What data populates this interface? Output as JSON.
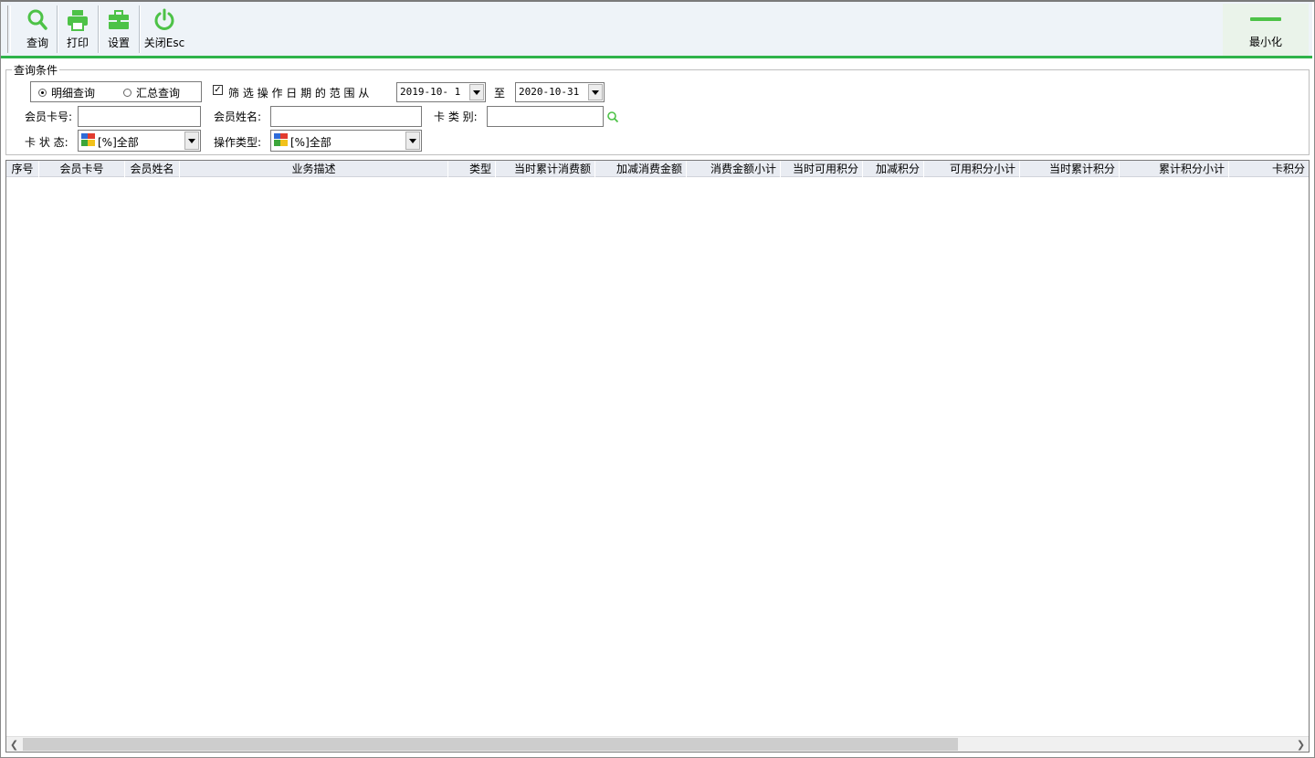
{
  "toolbar": {
    "query": {
      "label": "查询",
      "icon": "search-icon"
    },
    "print": {
      "label": "打印",
      "icon": "printer-icon"
    },
    "settings": {
      "label": "设置",
      "icon": "toolbox-icon"
    },
    "close": {
      "label": "关闭Esc",
      "icon": "power-icon"
    },
    "minimize": {
      "label": "最小化",
      "icon": "minimize-icon"
    },
    "accent_color": "#4dc247"
  },
  "conditions": {
    "legend": "查询条件",
    "mode_detail": "明细查询",
    "mode_summary": "汇总查询",
    "selected_mode": "明细查询",
    "date_filter_label": "筛 选 操 作 日 期 的 范 围 从",
    "date_filter_checked": true,
    "date_from": "2019-10- 1",
    "date_to_label": "至",
    "date_to": "2020-10-31",
    "card_no_label": "会员卡号:",
    "card_no_value": "",
    "member_name_label": "会员姓名:",
    "member_name_value": "",
    "card_type_label": "卡 类 别:",
    "card_type_value": "",
    "card_status_label": "卡 状 态:",
    "card_status_value": "[%]全部",
    "op_type_label": "操作类型:",
    "op_type_value": "[%]全部"
  },
  "grid": {
    "columns": [
      "序号",
      "会员卡号",
      "会员姓名",
      "业务描述",
      "类型",
      "当时累计消费额",
      "加减消费金额",
      "消费金额小计",
      "当时可用积分",
      "加减积分",
      "可用积分小计",
      "当时累计积分",
      "累计积分小计",
      "卡积分"
    ],
    "rows": []
  }
}
